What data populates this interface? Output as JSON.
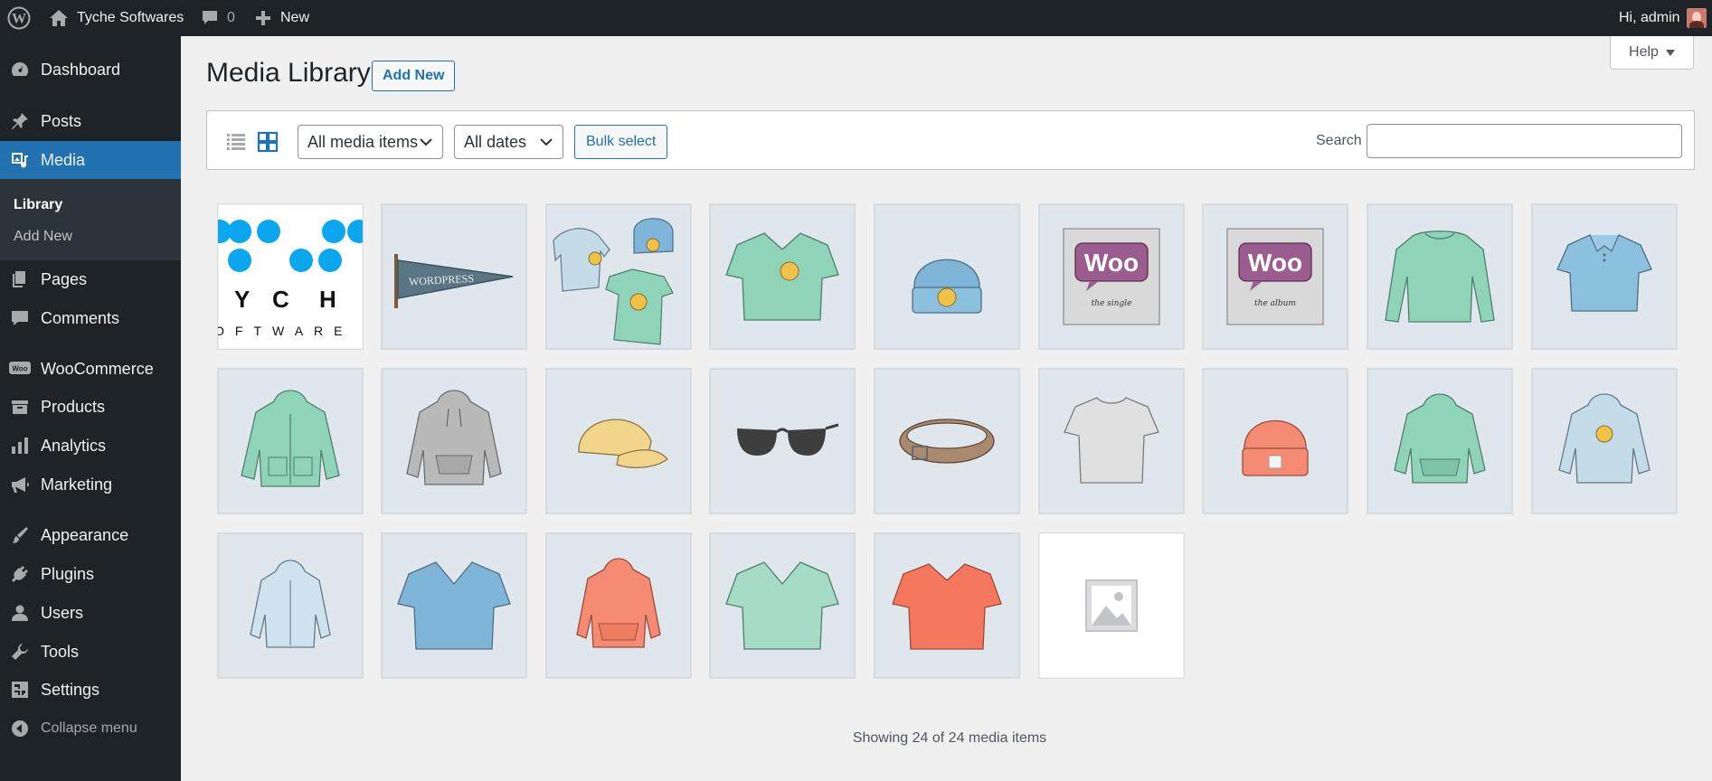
{
  "adminbar": {
    "site_name": "Tyche Softwares",
    "comments_count": "0",
    "new_label": "New",
    "greeting": "Hi, admin"
  },
  "sidebar": {
    "items": [
      {
        "label": "Dashboard",
        "icon": "dashboard-icon"
      },
      {
        "label": "Posts",
        "icon": "pin-icon"
      },
      {
        "label": "Media",
        "icon": "media-icon"
      },
      {
        "label": "Pages",
        "icon": "pages-icon"
      },
      {
        "label": "Comments",
        "icon": "comment-icon"
      },
      {
        "label": "WooCommerce",
        "icon": "woo-icon"
      },
      {
        "label": "Products",
        "icon": "archive-icon"
      },
      {
        "label": "Analytics",
        "icon": "bar-chart-icon"
      },
      {
        "label": "Marketing",
        "icon": "megaphone-icon"
      },
      {
        "label": "Appearance",
        "icon": "brush-icon"
      },
      {
        "label": "Plugins",
        "icon": "plug-icon"
      },
      {
        "label": "Users",
        "icon": "user-icon"
      },
      {
        "label": "Tools",
        "icon": "wrench-icon"
      },
      {
        "label": "Settings",
        "icon": "settings-icon"
      }
    ],
    "submenu": [
      {
        "label": "Library"
      },
      {
        "label": "Add New"
      }
    ],
    "collapse_label": "Collapse menu"
  },
  "help_label": "Help",
  "page": {
    "title": "Media Library",
    "add_new_label": "Add New"
  },
  "toolbar": {
    "media_filter": "All media items",
    "date_filter": "All dates",
    "bulk_select_label": "Bulk select",
    "search_label": "Search",
    "search_value": ""
  },
  "media_items": [
    {
      "name": "tyche-softwares-logo"
    },
    {
      "name": "pennant"
    },
    {
      "name": "logo-collection"
    },
    {
      "name": "vneck-tee"
    },
    {
      "name": "beanie-with-logo"
    },
    {
      "name": "single"
    },
    {
      "name": "album"
    },
    {
      "name": "long-sleeve-tee"
    },
    {
      "name": "polo"
    },
    {
      "name": "hoodie-green"
    },
    {
      "name": "hoodie-gray"
    },
    {
      "name": "cap"
    },
    {
      "name": "sunglasses"
    },
    {
      "name": "belt"
    },
    {
      "name": "tshirt"
    },
    {
      "name": "beanie"
    },
    {
      "name": "hoodie-with-zipper"
    },
    {
      "name": "hoodie-with-logo"
    },
    {
      "name": "hoodie-blue"
    },
    {
      "name": "vneck-tee-blue"
    },
    {
      "name": "hoodie-red"
    },
    {
      "name": "vneck-tee-green"
    },
    {
      "name": "tshirt-red"
    },
    {
      "name": "placeholder"
    }
  ],
  "footer_count": "Showing 24 of 24 media items"
}
